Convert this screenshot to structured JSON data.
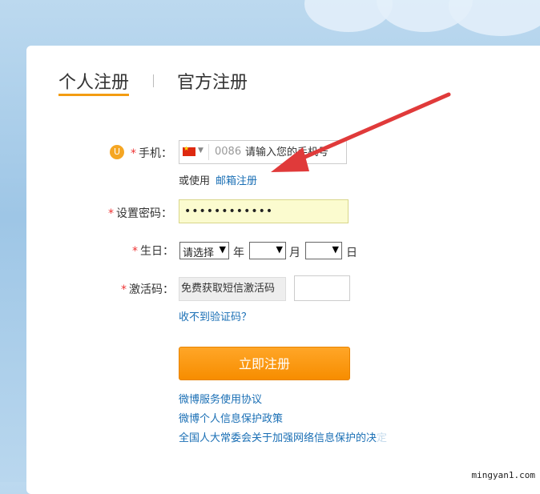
{
  "tabs": {
    "personal": "个人注册",
    "official": "官方注册"
  },
  "form": {
    "phone": {
      "label": "手机：",
      "country_code": "0086",
      "placeholder": "请输入您的手机号",
      "alt_prefix": "或使用",
      "alt_link": "邮箱注册"
    },
    "password": {
      "label": "设置密码：",
      "value": "••••••••••••"
    },
    "birthday": {
      "label": "生日：",
      "year_select": "请选择",
      "year_unit": "年",
      "month_unit": "月",
      "day_unit": "日"
    },
    "activation": {
      "label": "激活码：",
      "get_code_button": "免费获取短信激活码",
      "no_code_link": "收不到验证码？"
    },
    "submit_label": "立即注册"
  },
  "links": [
    "微博服务使用协议",
    "微博个人信息保护政策",
    "全国人大常委会关于加强网络信息保护的决定"
  ],
  "watermark": "mingyan1.com",
  "colors": {
    "accent": "#f78d00",
    "link": "#1a6fb5",
    "required": "#ee3333",
    "arrow": "#e03a3a"
  }
}
